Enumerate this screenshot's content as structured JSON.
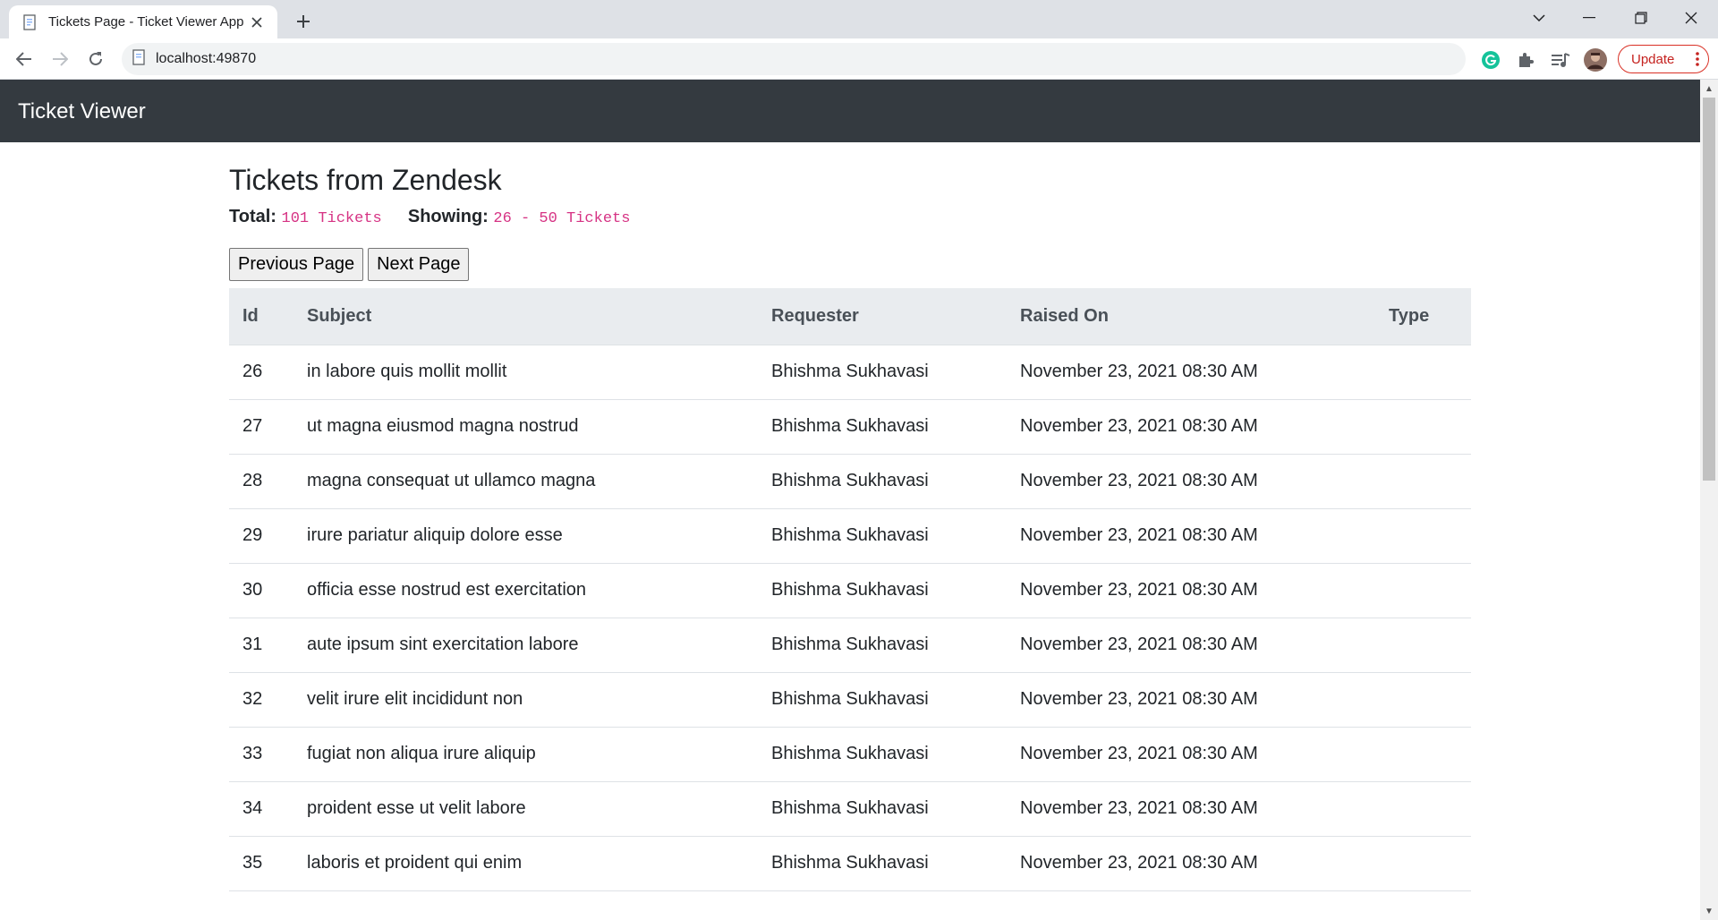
{
  "browser": {
    "tab_title": "Tickets Page - Ticket Viewer App",
    "url": "localhost:49870",
    "update_label": "Update"
  },
  "app": {
    "brand": "Ticket Viewer"
  },
  "page": {
    "title": "Tickets from Zendesk",
    "total_label": "Total:",
    "total_value": "101 Tickets",
    "showing_label": "Showing:",
    "showing_value": "26 - 50 Tickets",
    "prev_button": "Previous Page",
    "next_button": "Next Page"
  },
  "table": {
    "columns": [
      "Id",
      "Subject",
      "Requester",
      "Raised On",
      "Type"
    ],
    "rows": [
      {
        "id": "26",
        "subject": "in labore quis mollit mollit",
        "requester": "Bhishma Sukhavasi",
        "raised_on": "November 23, 2021 08:30 AM",
        "type": ""
      },
      {
        "id": "27",
        "subject": "ut magna eiusmod magna nostrud",
        "requester": "Bhishma Sukhavasi",
        "raised_on": "November 23, 2021 08:30 AM",
        "type": ""
      },
      {
        "id": "28",
        "subject": "magna consequat ut ullamco magna",
        "requester": "Bhishma Sukhavasi",
        "raised_on": "November 23, 2021 08:30 AM",
        "type": ""
      },
      {
        "id": "29",
        "subject": "irure pariatur aliquip dolore esse",
        "requester": "Bhishma Sukhavasi",
        "raised_on": "November 23, 2021 08:30 AM",
        "type": ""
      },
      {
        "id": "30",
        "subject": "officia esse nostrud est exercitation",
        "requester": "Bhishma Sukhavasi",
        "raised_on": "November 23, 2021 08:30 AM",
        "type": ""
      },
      {
        "id": "31",
        "subject": "aute ipsum sint exercitation labore",
        "requester": "Bhishma Sukhavasi",
        "raised_on": "November 23, 2021 08:30 AM",
        "type": ""
      },
      {
        "id": "32",
        "subject": "velit irure elit incididunt non",
        "requester": "Bhishma Sukhavasi",
        "raised_on": "November 23, 2021 08:30 AM",
        "type": ""
      },
      {
        "id": "33",
        "subject": "fugiat non aliqua irure aliquip",
        "requester": "Bhishma Sukhavasi",
        "raised_on": "November 23, 2021 08:30 AM",
        "type": ""
      },
      {
        "id": "34",
        "subject": "proident esse ut velit labore",
        "requester": "Bhishma Sukhavasi",
        "raised_on": "November 23, 2021 08:30 AM",
        "type": ""
      },
      {
        "id": "35",
        "subject": "laboris et proident qui enim",
        "requester": "Bhishma Sukhavasi",
        "raised_on": "November 23, 2021 08:30 AM",
        "type": ""
      }
    ]
  }
}
